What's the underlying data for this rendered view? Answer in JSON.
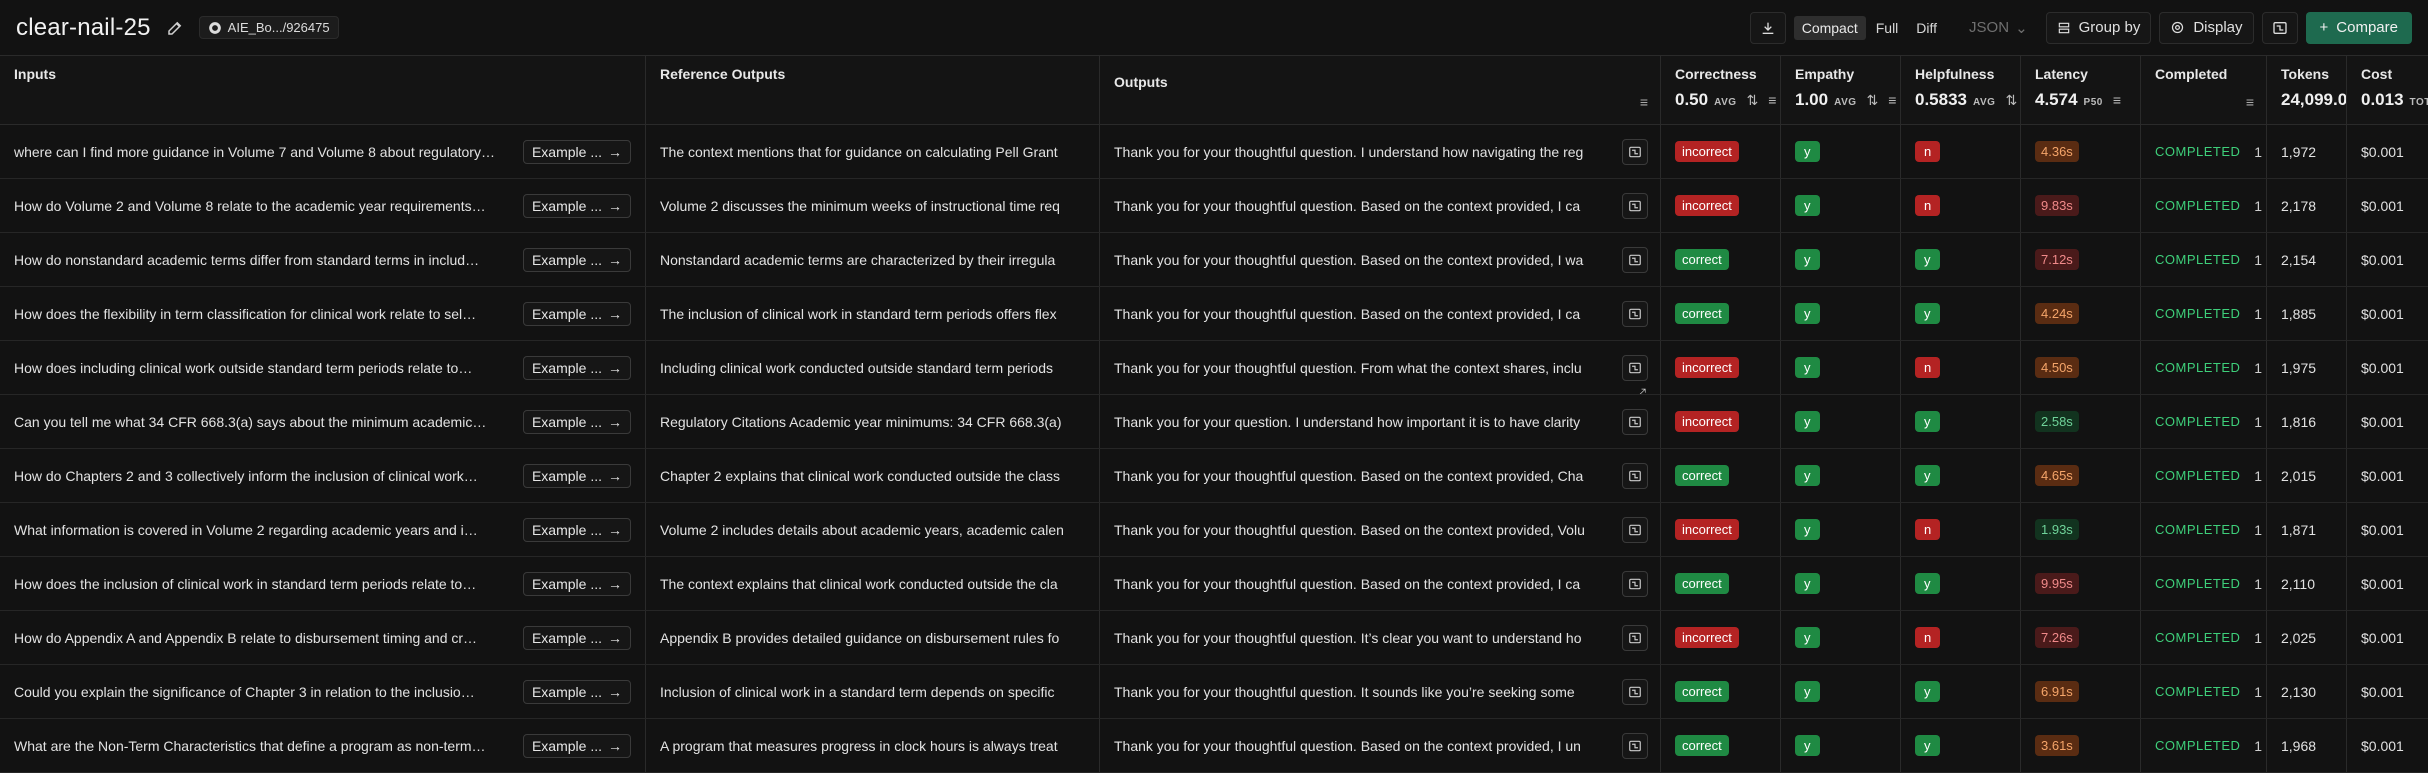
{
  "header": {
    "title": "clear-nail-25",
    "repo_label": "AIE_Bo.../926475",
    "view_modes": [
      "Compact",
      "Full",
      "Diff"
    ],
    "active_view": "Compact",
    "format_select": "JSON",
    "group_by_label": "Group by",
    "display_label": "Display",
    "compare_label": "Compare"
  },
  "columns": {
    "inputs": "Inputs",
    "reference": "Reference Outputs",
    "outputs": "Outputs",
    "correctness": {
      "label": "Correctness",
      "value": "0.50",
      "agg": "AVG"
    },
    "empathy": {
      "label": "Empathy",
      "value": "1.00",
      "agg": "AVG"
    },
    "helpfulness": {
      "label": "Helpfulness",
      "value": "0.5833",
      "agg": "AVG"
    },
    "latency": {
      "label": "Latency",
      "value": "4.574",
      "agg": "P50"
    },
    "completed": "Completed",
    "tokens": {
      "label": "Tokens",
      "value": "24,099.0"
    },
    "cost": {
      "label": "Cost",
      "value": "0.013",
      "agg": "TOT"
    }
  },
  "example_label": "Example ...",
  "rows": [
    {
      "input": "where can I find more guidance in Volume 7 and Volume 8 about regulatory…",
      "reference": "The context mentions that for guidance on calculating Pell Grant",
      "output": "Thank you for your thoughtful question. I understand how navigating the reg",
      "correctness": "incorrect",
      "empathy": "y",
      "helpfulness": "n",
      "latency": "4.36s",
      "lat_level": "o",
      "status": "COMPLETED",
      "tokens": "1,972",
      "cost": "$0.001"
    },
    {
      "input": "How do Volume 2 and Volume 8 relate to the academic year requirements…",
      "reference": "Volume 2 discusses the minimum weeks of instructional time req",
      "output": "Thank you for your thoughtful question. Based on the context provided, I ca",
      "correctness": "incorrect",
      "empathy": "y",
      "helpfulness": "n",
      "latency": "9.83s",
      "lat_level": "r",
      "status": "COMPLETED",
      "tokens": "2,178",
      "cost": "$0.001"
    },
    {
      "input": "How do nonstandard academic terms differ from standard terms in includ…",
      "reference": "Nonstandard academic terms are characterized by their irregula",
      "output": "Thank you for your thoughtful question. Based on the context provided, I wa",
      "correctness": "correct",
      "empathy": "y",
      "helpfulness": "y",
      "latency": "7.12s",
      "lat_level": "r",
      "status": "COMPLETED",
      "tokens": "2,154",
      "cost": "$0.001"
    },
    {
      "input": "How does the flexibility in term classification for clinical work relate to sel…",
      "reference": "The inclusion of clinical work in standard term periods offers flex",
      "output": "Thank you for your thoughtful question. Based on the context provided, I ca",
      "correctness": "correct",
      "empathy": "y",
      "helpfulness": "y",
      "latency": "4.24s",
      "lat_level": "o",
      "status": "COMPLETED",
      "tokens": "1,885",
      "cost": "$0.001"
    },
    {
      "input": "How does including clinical work outside standard term periods relate to…",
      "reference": "Including clinical work conducted outside standard term periods",
      "output": "Thank you for your thoughtful question. From what the context shares, inclu",
      "correctness": "incorrect",
      "empathy": "y",
      "helpfulness": "n",
      "latency": "4.50s",
      "lat_level": "o",
      "status": "COMPLETED",
      "tokens": "1,975",
      "cost": "$0.001"
    },
    {
      "input": "Can you tell me what 34 CFR 668.3(a) says about the minimum academic…",
      "reference": "Regulatory Citations Academic year minimums: 34 CFR 668.3(a)",
      "output": "Thank you for your question. I understand how important it is to have clarity",
      "correctness": "incorrect",
      "empathy": "y",
      "helpfulness": "y",
      "latency": "2.58s",
      "lat_level": "g",
      "status": "COMPLETED",
      "tokens": "1,816",
      "cost": "$0.001"
    },
    {
      "input": "How do Chapters 2 and 3 collectively inform the inclusion of clinical work…",
      "reference": "Chapter 2 explains that clinical work conducted outside the class",
      "output": "Thank you for your thoughtful question. Based on the context provided, Cha",
      "correctness": "correct",
      "empathy": "y",
      "helpfulness": "y",
      "latency": "4.65s",
      "lat_level": "o",
      "status": "COMPLETED",
      "tokens": "2,015",
      "cost": "$0.001"
    },
    {
      "input": "What information is covered in Volume 2 regarding academic years and i…",
      "reference": "Volume 2 includes details about academic years, academic calen",
      "output": "Thank you for your thoughtful question. Based on the context provided, Volu",
      "correctness": "incorrect",
      "empathy": "y",
      "helpfulness": "n",
      "latency": "1.93s",
      "lat_level": "g",
      "status": "COMPLETED",
      "tokens": "1,871",
      "cost": "$0.001"
    },
    {
      "input": "How does the inclusion of clinical work in standard term periods relate to…",
      "reference": "The context explains that clinical work conducted outside the cla",
      "output": "Thank you for your thoughtful question. Based on the context provided, I ca",
      "correctness": "correct",
      "empathy": "y",
      "helpfulness": "y",
      "latency": "9.95s",
      "lat_level": "r",
      "status": "COMPLETED",
      "tokens": "2,110",
      "cost": "$0.001"
    },
    {
      "input": "How do Appendix A and Appendix B relate to disbursement timing and cr…",
      "reference": "Appendix B provides detailed guidance on disbursement rules fo",
      "output": "Thank you for your thoughtful question. It’s clear you want to understand ho",
      "correctness": "incorrect",
      "empathy": "y",
      "helpfulness": "n",
      "latency": "7.26s",
      "lat_level": "r",
      "status": "COMPLETED",
      "tokens": "2,025",
      "cost": "$0.001"
    },
    {
      "input": "Could you explain the significance of Chapter 3 in relation to the inclusio…",
      "reference": "Inclusion of clinical work in a standard term depends on specific",
      "output": "Thank you for your thoughtful question. It sounds like you’re seeking some",
      "correctness": "correct",
      "empathy": "y",
      "helpfulness": "y",
      "latency": "6.91s",
      "lat_level": "o",
      "status": "COMPLETED",
      "tokens": "2,130",
      "cost": "$0.001"
    },
    {
      "input": "What are the Non-Term Characteristics that define a program as non-term…",
      "reference": "A program that measures progress in clock hours is always treat",
      "output": "Thank you for your thoughtful question. Based on the context provided, I un",
      "correctness": "correct",
      "empathy": "y",
      "helpfulness": "y",
      "latency": "3.61s",
      "lat_level": "o",
      "status": "COMPLETED",
      "tokens": "1,968",
      "cost": "$0.001"
    }
  ],
  "completed_suffix": "1"
}
